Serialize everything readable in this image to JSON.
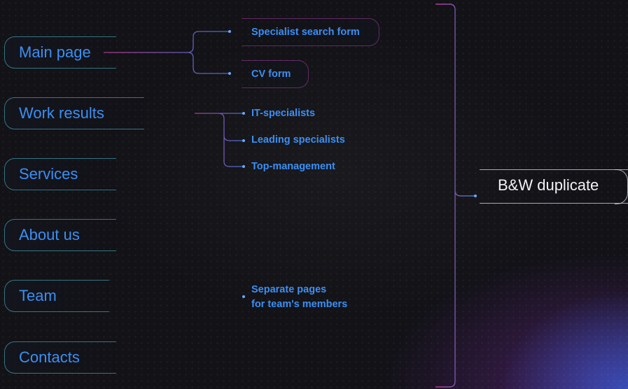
{
  "main_items": [
    {
      "label": "Main page"
    },
    {
      "label": "Work results"
    },
    {
      "label": "Services"
    },
    {
      "label": "About us"
    },
    {
      "label": "Team"
    },
    {
      "label": "Contacts"
    }
  ],
  "main_page_children": [
    {
      "label": "Specialist search form"
    },
    {
      "label": "CV form"
    }
  ],
  "work_results_children": [
    {
      "label": "IT-specialists"
    },
    {
      "label": "Leading specialists"
    },
    {
      "label": "Top-management"
    }
  ],
  "team_child": {
    "line1": "Separate pages",
    "line2": "for team's members"
  },
  "duplicate": {
    "label": "B&W duplicate"
  },
  "colors": {
    "background": "#121217",
    "text_accent": "#3b8ff4",
    "node_border": "#4aaabe",
    "connector": "#9a4fd0",
    "duplicate_text": "#f2f2f4"
  }
}
